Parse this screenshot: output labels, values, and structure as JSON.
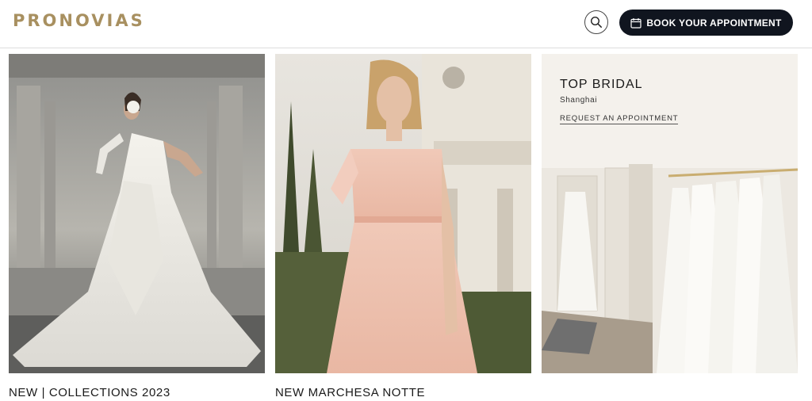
{
  "header": {
    "logo_text": "PRONOVIAS",
    "book_label": "BOOK YOUR APPOINTMENT"
  },
  "cards": [
    {
      "title": "NEW | COLLECTIONS 2023"
    },
    {
      "title": "NEW MARCHESA NOTTE"
    }
  ],
  "store": {
    "name": "TOP BRIDAL",
    "city": "Shanghai",
    "link_label": "REQUEST AN APPOINTMENT"
  },
  "colors": {
    "brand_gold": "#a89060",
    "button_dark": "#10151f",
    "panel_bg": "#f4f1ec"
  },
  "icons": [
    "search-icon",
    "calendar-icon"
  ]
}
